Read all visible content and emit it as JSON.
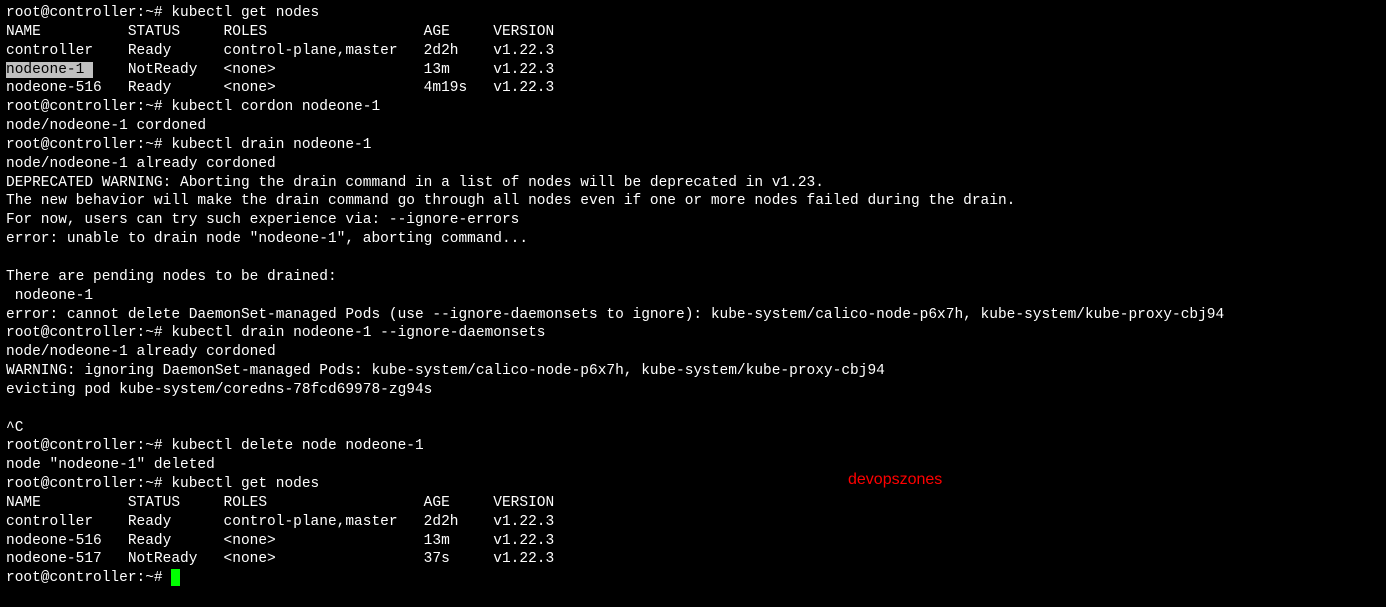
{
  "prompt_prefix": "root@controller:~# ",
  "commands": {
    "get_nodes_1": "kubectl get nodes",
    "cordon": "kubectl cordon nodeone-1",
    "drain_1": "kubectl drain nodeone-1",
    "drain_2": "kubectl drain nodeone-1 --ignore-daemonsets",
    "delete": "kubectl delete node nodeone-1",
    "get_nodes_2": "kubectl get nodes"
  },
  "headers_line": "NAME          STATUS     ROLES                  AGE     VERSION",
  "table1": {
    "row1": "controller    Ready      control-plane,master   2d2h    v1.22.3",
    "row2_highlight": "nodeone-1 ",
    "row2_rest": "    NotReady   <none>                 13m     v1.22.3",
    "row3": "nodeone-516   Ready      <none>                 4m19s   v1.22.3"
  },
  "output": {
    "cordoned": "node/nodeone-1 cordoned",
    "already_cordoned": "node/nodeone-1 already cordoned",
    "deprecated": "DEPRECATED WARNING: Aborting the drain command in a list of nodes will be deprecated in v1.23.",
    "new_behavior": "The new behavior will make the drain command go through all nodes even if one or more nodes failed during the drain.",
    "for_now": "For now, users can try such experience via: --ignore-errors",
    "error_drain": "error: unable to drain node \"nodeone-1\", aborting command...",
    "blank": "",
    "pending": "There are pending nodes to be drained:",
    "pending_node": " nodeone-1",
    "error_daemonset": "error: cannot delete DaemonSet-managed Pods (use --ignore-daemonsets to ignore): kube-system/calico-node-p6x7h, kube-system/kube-proxy-cbj94",
    "warning_ignore": "WARNING: ignoring DaemonSet-managed Pods: kube-system/calico-node-p6x7h, kube-system/kube-proxy-cbj94",
    "evicting": "evicting pod kube-system/coredns-78fcd69978-zg94s",
    "ctrl_c": "^C",
    "deleted": "node \"nodeone-1\" deleted"
  },
  "table2": {
    "row1": "controller    Ready      control-plane,master   2d2h    v1.22.3",
    "row2": "nodeone-516   Ready      <none>                 13m     v1.22.3",
    "row3": "nodeone-517   NotReady   <none>                 37s     v1.22.3"
  },
  "watermark": "devopszones"
}
